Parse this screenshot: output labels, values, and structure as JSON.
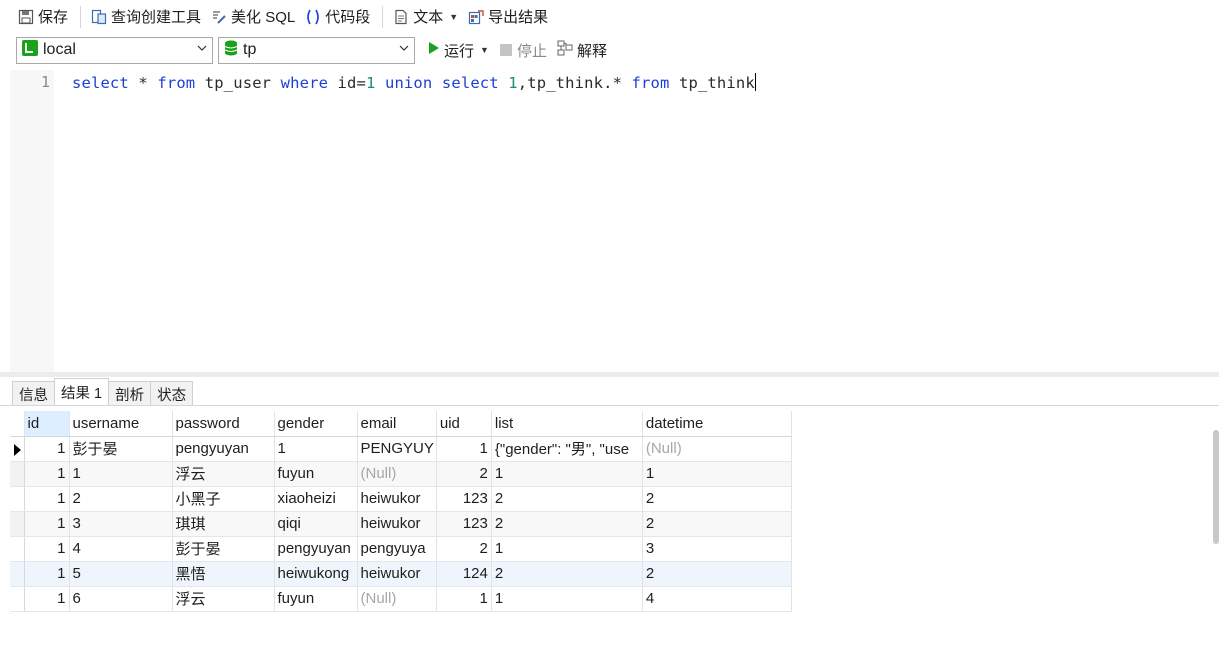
{
  "toolbar": {
    "save_label": "保存",
    "query_builder_label": "查询创建工具",
    "beautify_label": "美化 SQL",
    "snippet_label": "代码段",
    "text_label": "文本",
    "export_label": "导出结果"
  },
  "connection": {
    "selected": "local"
  },
  "database": {
    "selected": "tp"
  },
  "run": {
    "run_label": "运行",
    "stop_label": "停止",
    "explain_label": "解释"
  },
  "editor": {
    "line_number": "1",
    "tokens": [
      {
        "t": "select",
        "c": "kw"
      },
      {
        "t": " * ",
        "c": "id"
      },
      {
        "t": "from",
        "c": "kw"
      },
      {
        "t": " tp_user ",
        "c": "id"
      },
      {
        "t": "where",
        "c": "kw"
      },
      {
        "t": " id=",
        "c": "id"
      },
      {
        "t": "1",
        "c": "num"
      },
      {
        "t": " ",
        "c": "id"
      },
      {
        "t": "union",
        "c": "kw"
      },
      {
        "t": " ",
        "c": "id"
      },
      {
        "t": "select",
        "c": "kw"
      },
      {
        "t": " ",
        "c": "id"
      },
      {
        "t": "1",
        "c": "num"
      },
      {
        "t": ",tp_think.* ",
        "c": "id"
      },
      {
        "t": "from",
        "c": "kw"
      },
      {
        "t": " tp_think",
        "c": "id"
      }
    ]
  },
  "result_tabs": [
    "信息",
    "结果 1",
    "剖析",
    "状态"
  ],
  "active_tab": "结果 1",
  "grid": {
    "columns": [
      "id",
      "username",
      "password",
      "gender",
      "email",
      "uid",
      "list",
      "datetime"
    ],
    "rows": [
      [
        "1",
        "彭于晏",
        "pengyuyan",
        "1",
        "PENGYUY",
        "1",
        "{\"gender\": \"男\", \"use",
        "(Null)"
      ],
      [
        "1",
        "1",
        "浮云",
        "fuyun",
        "(Null)",
        "2",
        "1",
        "1"
      ],
      [
        "1",
        "2",
        "小黑子",
        "xiaoheizi",
        "heiwukor",
        "123",
        "2",
        "2"
      ],
      [
        "1",
        "3",
        "琪琪",
        "qiqi",
        "heiwukor",
        "123",
        "2",
        "2"
      ],
      [
        "1",
        "4",
        "彭于晏",
        "pengyuyan",
        "pengyuya",
        "2",
        "1",
        "3"
      ],
      [
        "1",
        "5",
        "黑悟",
        "heiwukong",
        "heiwukor",
        "124",
        "2",
        "2"
      ],
      [
        "1",
        "6",
        "浮云",
        "fuyun",
        "(Null)",
        "1",
        "1",
        "4"
      ]
    ]
  },
  "colors": {
    "keyword": "#1c3fd8",
    "number": "#1c8c7c",
    "null_text": "#a7a7a7",
    "run_green": "#1aa31a"
  }
}
